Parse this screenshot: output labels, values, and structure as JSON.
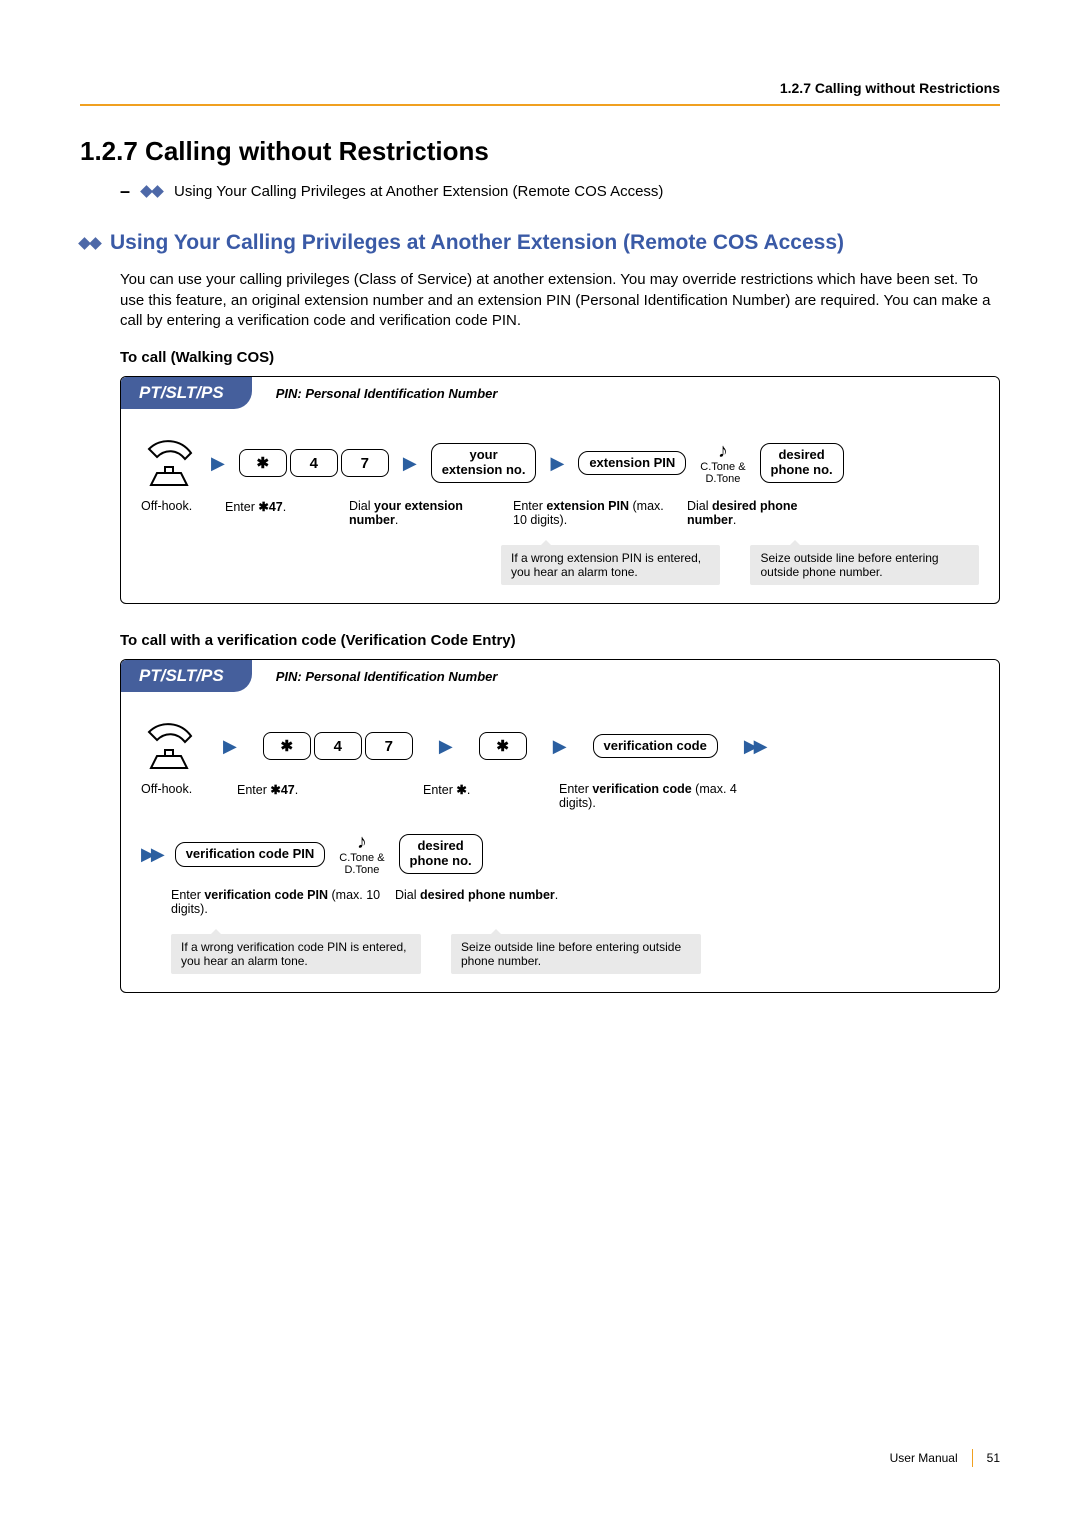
{
  "header": {
    "running": "1.2.7 Calling without Restrictions"
  },
  "section": {
    "number_title": "1.2.7  Calling without Restrictions",
    "toc_item": "Using Your Calling Privileges at Another Extension (Remote COS Access)"
  },
  "subsection": {
    "title": "Using Your Calling Privileges at Another Extension (Remote COS Access)",
    "paragraph": "You can use your calling privileges (Class of Service) at another extension. You may override restrictions which have been set. To use this feature, an original extension number and an extension PIN (Personal Identification Number) are required. You can make a call by entering a verification code and verification code PIN."
  },
  "procedure1": {
    "heading": "To call (Walking COS)",
    "device_tab": "PT/SLT/PS",
    "pin_note": "PIN: Personal Identification Number",
    "keys": {
      "star": "✱",
      "four": "4",
      "seven": "7"
    },
    "box_your_ext": "your\nextension no.",
    "box_ext_pin": "extension PIN",
    "tone_label1": "C.Tone &",
    "tone_label2": "D.Tone",
    "box_desired": "desired\nphone no.",
    "cap_offhook": "Off-hook.",
    "cap_enter47_pre": "Enter ",
    "cap_enter47_code": "✱47",
    "cap_enter47_post": ".",
    "cap_dial_ext_pre": "Dial ",
    "cap_dial_ext_bold": "your extension number",
    "cap_dial_ext_post": ".",
    "cap_ext_pin_pre": "Enter ",
    "cap_ext_pin_bold": "extension PIN",
    "cap_ext_pin_post": " (max. 10 digits).",
    "cap_dial_desired_pre": "Dial ",
    "cap_dial_desired_bold": "desired phone number",
    "cap_dial_desired_post": ".",
    "hint_wrong_pin": "If a wrong extension PIN is entered, you hear an alarm tone.",
    "hint_seize": "Seize outside line before entering outside phone number."
  },
  "procedure2": {
    "heading": "To call with a verification code (Verification Code Entry)",
    "device_tab": "PT/SLT/PS",
    "pin_note": "PIN: Personal Identification Number",
    "keys": {
      "star": "✱",
      "four": "4",
      "seven": "7",
      "star2": "✱"
    },
    "box_verif_code": "verification code",
    "box_verif_pin": "verification code PIN",
    "box_desired": "desired\nphone no.",
    "tone_label1": "C.Tone &",
    "tone_label2": "D.Tone",
    "cap_offhook": "Off-hook.",
    "cap_enter47_pre": "Enter ",
    "cap_enter47_code": "✱47",
    "cap_enter47_post": ".",
    "cap_enter_star_pre": "Enter ",
    "cap_enter_star_code": "✱",
    "cap_enter_star_post": ".",
    "cap_verif_code_pre": "Enter ",
    "cap_verif_code_bold": "verification code",
    "cap_verif_code_post": " (max. 4 digits).",
    "cap_verif_pin_pre": "Enter ",
    "cap_verif_pin_bold": "verification code PIN",
    "cap_verif_pin_post": " (max. 10 digits).",
    "cap_dial_desired_pre": "Dial ",
    "cap_dial_desired_bold": "desired phone number",
    "cap_dial_desired_post": ".",
    "hint_wrong_pin": "If a wrong verification code PIN is entered, you hear an alarm tone.",
    "hint_seize": "Seize outside line before entering outside phone number."
  },
  "footer": {
    "label": "User Manual",
    "page": "51"
  }
}
